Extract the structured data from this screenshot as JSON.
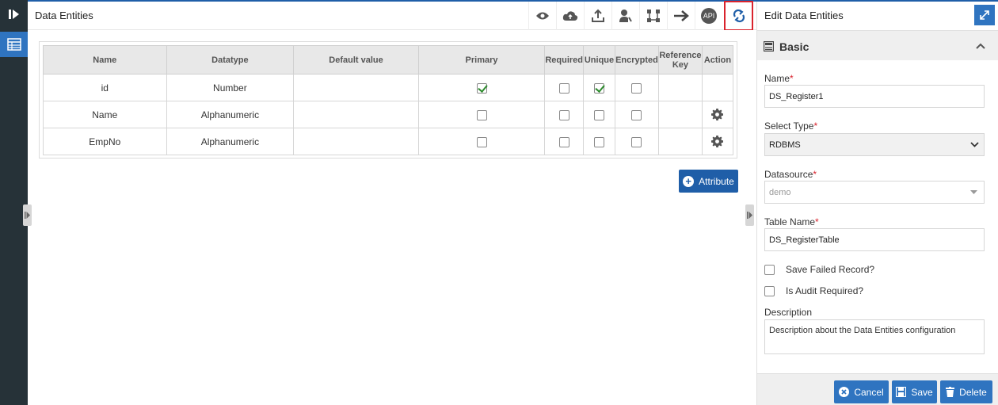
{
  "app": {
    "title": "Data Entities"
  },
  "toolbar": {
    "icons": [
      "eye-icon",
      "cloud-icon",
      "upload-icon",
      "user-key-icon",
      "graph-icon",
      "arrow-right-icon",
      "api-icon",
      "refresh-icon"
    ],
    "api_label": "API",
    "active_index": 7
  },
  "table": {
    "headers": [
      "Name",
      "Datatype",
      "Default value",
      "Primary",
      "Required",
      "Unique",
      "Encrypted",
      "Reference Key",
      "Action"
    ],
    "rows": [
      {
        "name": "id",
        "datatype": "Number",
        "default": "",
        "primary": true,
        "required": false,
        "unique": true,
        "encrypted": false,
        "reference": "",
        "action": false
      },
      {
        "name": "Name",
        "datatype": "Alphanumeric",
        "default": "",
        "primary": false,
        "required": false,
        "unique": false,
        "encrypted": false,
        "reference": "",
        "action": true
      },
      {
        "name": "EmpNo",
        "datatype": "Alphanumeric",
        "default": "",
        "primary": false,
        "required": false,
        "unique": false,
        "encrypted": false,
        "reference": "",
        "action": true
      }
    ]
  },
  "attribute_button": "Attribute",
  "panel": {
    "title": "Edit Data Entities",
    "section": "Basic",
    "name_label": "Name",
    "name_value": "DS_Register1",
    "type_label": "Select Type",
    "type_value": "RDBMS",
    "datasource_label": "Datasource",
    "datasource_value": "demo",
    "table_label": "Table Name",
    "table_value": "DS_RegisterTable",
    "save_failed_label": "Save Failed Record?",
    "audit_label": "Is Audit Required?",
    "description_label": "Description",
    "description_value": "Description about the Data Entities configuration",
    "required_mark": "*"
  },
  "footer": {
    "cancel": "Cancel",
    "save": "Save",
    "delete": "Delete"
  },
  "colors": {
    "accent": "#2f74c0",
    "dark_accent": "#1f5ea8",
    "sidebar": "#263238",
    "highlight": "#d9232d"
  }
}
